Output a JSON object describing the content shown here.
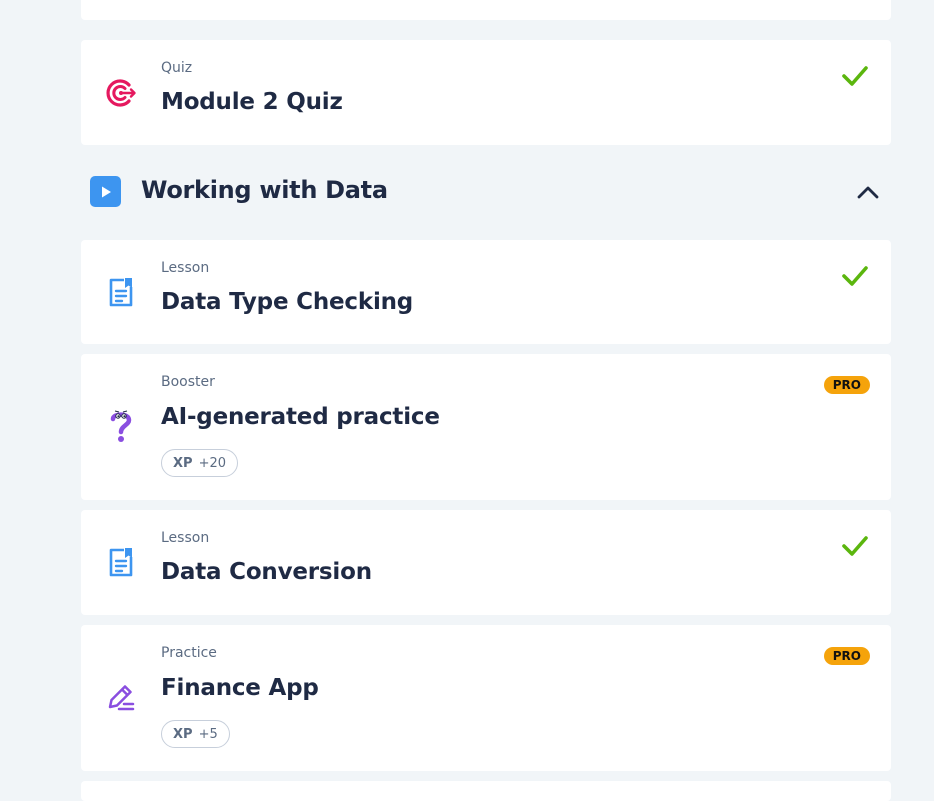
{
  "items": [
    {
      "kind": "Quiz",
      "title": "Module 2 Quiz",
      "icon": "target-icon",
      "completed": true
    },
    {
      "kind": "Lesson",
      "title": "Data Type Checking",
      "icon": "lesson-doc-icon",
      "completed": true
    },
    {
      "kind": "Booster",
      "title": "AI-generated practice",
      "icon": "question-mark-icon",
      "badge": "PRO",
      "xp_label": "XP",
      "xp_value": "+20"
    },
    {
      "kind": "Lesson",
      "title": "Data Conversion",
      "icon": "lesson-doc-icon",
      "completed": true
    },
    {
      "kind": "Practice",
      "title": "Finance App",
      "icon": "pencil-icon",
      "badge": "PRO",
      "xp_label": "XP",
      "xp_value": "+5"
    }
  ],
  "section": {
    "title": "Working with Data",
    "icon": "play-icon",
    "expanded": true
  },
  "colors": {
    "background": "#f1f5f8",
    "card": "#ffffff",
    "check_green": "#5bb60e",
    "pro_badge": "#f5a30b",
    "lesson_blue": "#3d95f0",
    "quiz_red": "#e5195f",
    "booster_purple": "#8a4ee0"
  }
}
